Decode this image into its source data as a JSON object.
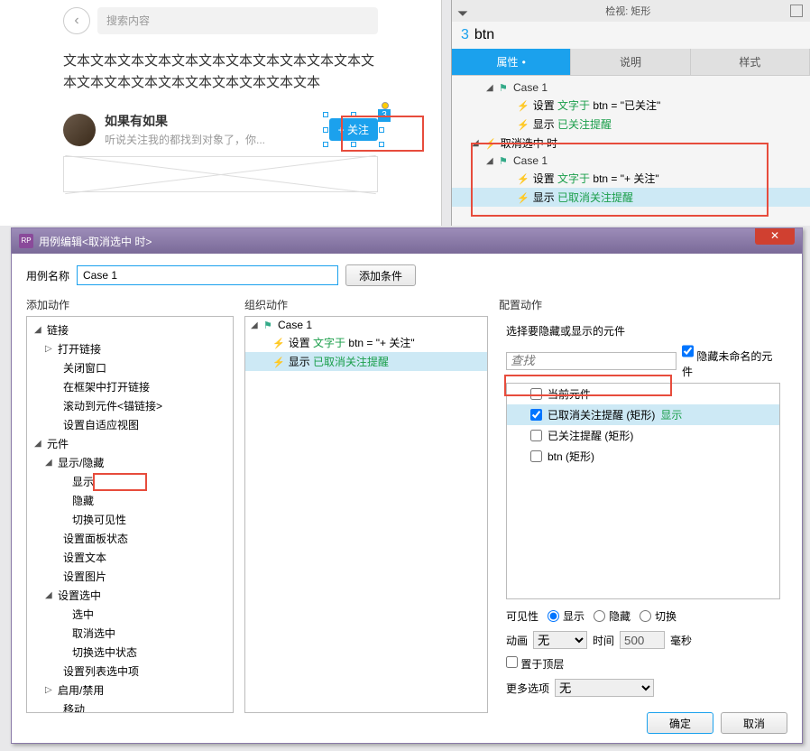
{
  "preview": {
    "search_placeholder": "搜索内容",
    "content_text": "文本文本文本文本文本文本文本文本文本文本文本文本文本文本文本文本文本文本文本文本文本",
    "username": "如果有如果",
    "user_desc": "听说关注我的都找到对象了，你...",
    "follow_label": "+ 关注",
    "footnote": "3"
  },
  "inspector": {
    "title": "检视: 矩形",
    "shape_num": "3",
    "shape_name": "btn",
    "tabs": {
      "props": "属性",
      "desc": "说明",
      "style": "样式"
    },
    "tree": {
      "case1": "Case 1",
      "set_text1_prefix": "设置 ",
      "set_text1_green": "文字于",
      "set_text1_suffix": " btn = \"已关注\"",
      "show1_prefix": "显示 ",
      "show1_green": "已关注提醒",
      "unselect": "取消选中 时",
      "case2": "Case 1",
      "set_text2_prefix": "设置 ",
      "set_text2_green": "文字于",
      "set_text2_suffix": " btn = \"+ 关注\"",
      "show2_prefix": "显示 ",
      "show2_green": "已取消关注提醒"
    }
  },
  "dialog": {
    "title": "用例编辑<取消选中 时>",
    "rp": "RP",
    "case_name_label": "用例名称",
    "case_name_value": "Case 1",
    "add_condition": "添加条件",
    "col1_header": "添加动作",
    "col2_header": "组织动作",
    "col3_header": "配置动作",
    "actions": {
      "links": "链接",
      "open_link": "打开链接",
      "close_window": "关闭窗口",
      "open_in_frame": "在框架中打开链接",
      "scroll_to": "滚动到元件<锚链接>",
      "set_adaptive": "设置自适应视图",
      "widgets": "元件",
      "show_hide": "显示/隐藏",
      "show": "显示",
      "hide": "隐藏",
      "toggle_vis": "切换可见性",
      "panel_state": "设置面板状态",
      "set_text": "设置文本",
      "set_image": "设置图片",
      "set_selected": "设置选中",
      "selected": "选中",
      "unselected": "取消选中",
      "toggle_sel": "切换选中状态",
      "set_list_sel": "设置列表选中项",
      "enable_disable": "启用/禁用",
      "move": "移动"
    },
    "case_tree": {
      "case": "Case 1",
      "set_prefix": "设置 ",
      "set_green": "文字于",
      "set_suffix": " btn = \"+ 关注\"",
      "show_prefix": "显示 ",
      "show_green": "已取消关注提醒"
    },
    "config": {
      "select_label": "选择要隐藏或显示的元件",
      "search_placeholder": "查找",
      "hide_unnamed": "隐藏未命名的元件",
      "widgets": {
        "current": "当前元件",
        "w1": "已取消关注提醒 (矩形)",
        "w1_suffix": "显示",
        "w2": "已关注提醒 (矩形)",
        "w3": "btn (矩形)"
      },
      "visibility_label": "可见性",
      "vis_show": "显示",
      "vis_hide": "隐藏",
      "vis_toggle": "切换",
      "anim_label": "动画",
      "anim_value": "无",
      "time_label": "时间",
      "time_value": "500",
      "time_unit": "毫秒",
      "bring_front": "置于顶层",
      "more_label": "更多选项",
      "more_value": "无"
    },
    "ok": "确定",
    "cancel": "取消"
  }
}
